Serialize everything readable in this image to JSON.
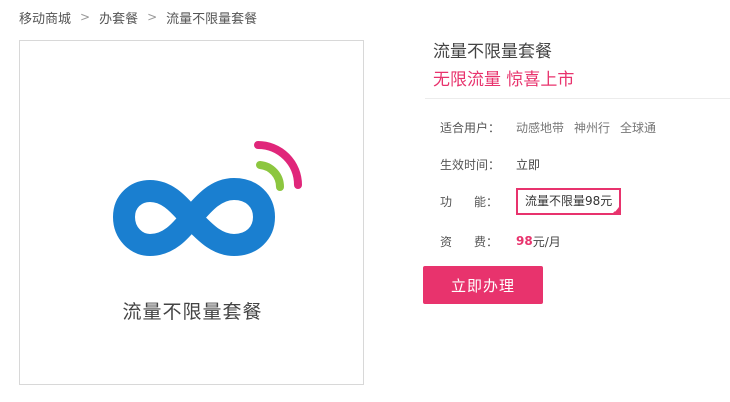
{
  "breadcrumb": {
    "items": [
      "移动商城",
      "办套餐",
      "流量不限量套餐"
    ],
    "separator": ">"
  },
  "product": {
    "image_caption": "流量不限量套餐",
    "title": "流量不限量套餐",
    "slogan": "无限流量 惊喜上市"
  },
  "details": {
    "users_label": "适合用户：",
    "users": [
      "动感地带",
      "神州行",
      "全球通"
    ],
    "effective_label": "生效时间：",
    "effective_value": "立即",
    "function_label_a": "功",
    "function_label_b": "能：",
    "function_option": "流量不限量98元",
    "fee_label_a": "资",
    "fee_label_b": "费：",
    "fee_amount": "98",
    "fee_unit": "元/月"
  },
  "actions": {
    "buy_label": "立即办理"
  },
  "colors": {
    "accent": "#e8336d",
    "logo_blue": "#1a7fd0",
    "logo_green": "#8cc63f",
    "logo_magenta": "#e0267a"
  },
  "icons": {
    "logo": "infinity-signal-logo",
    "selected_check": "check-icon"
  }
}
